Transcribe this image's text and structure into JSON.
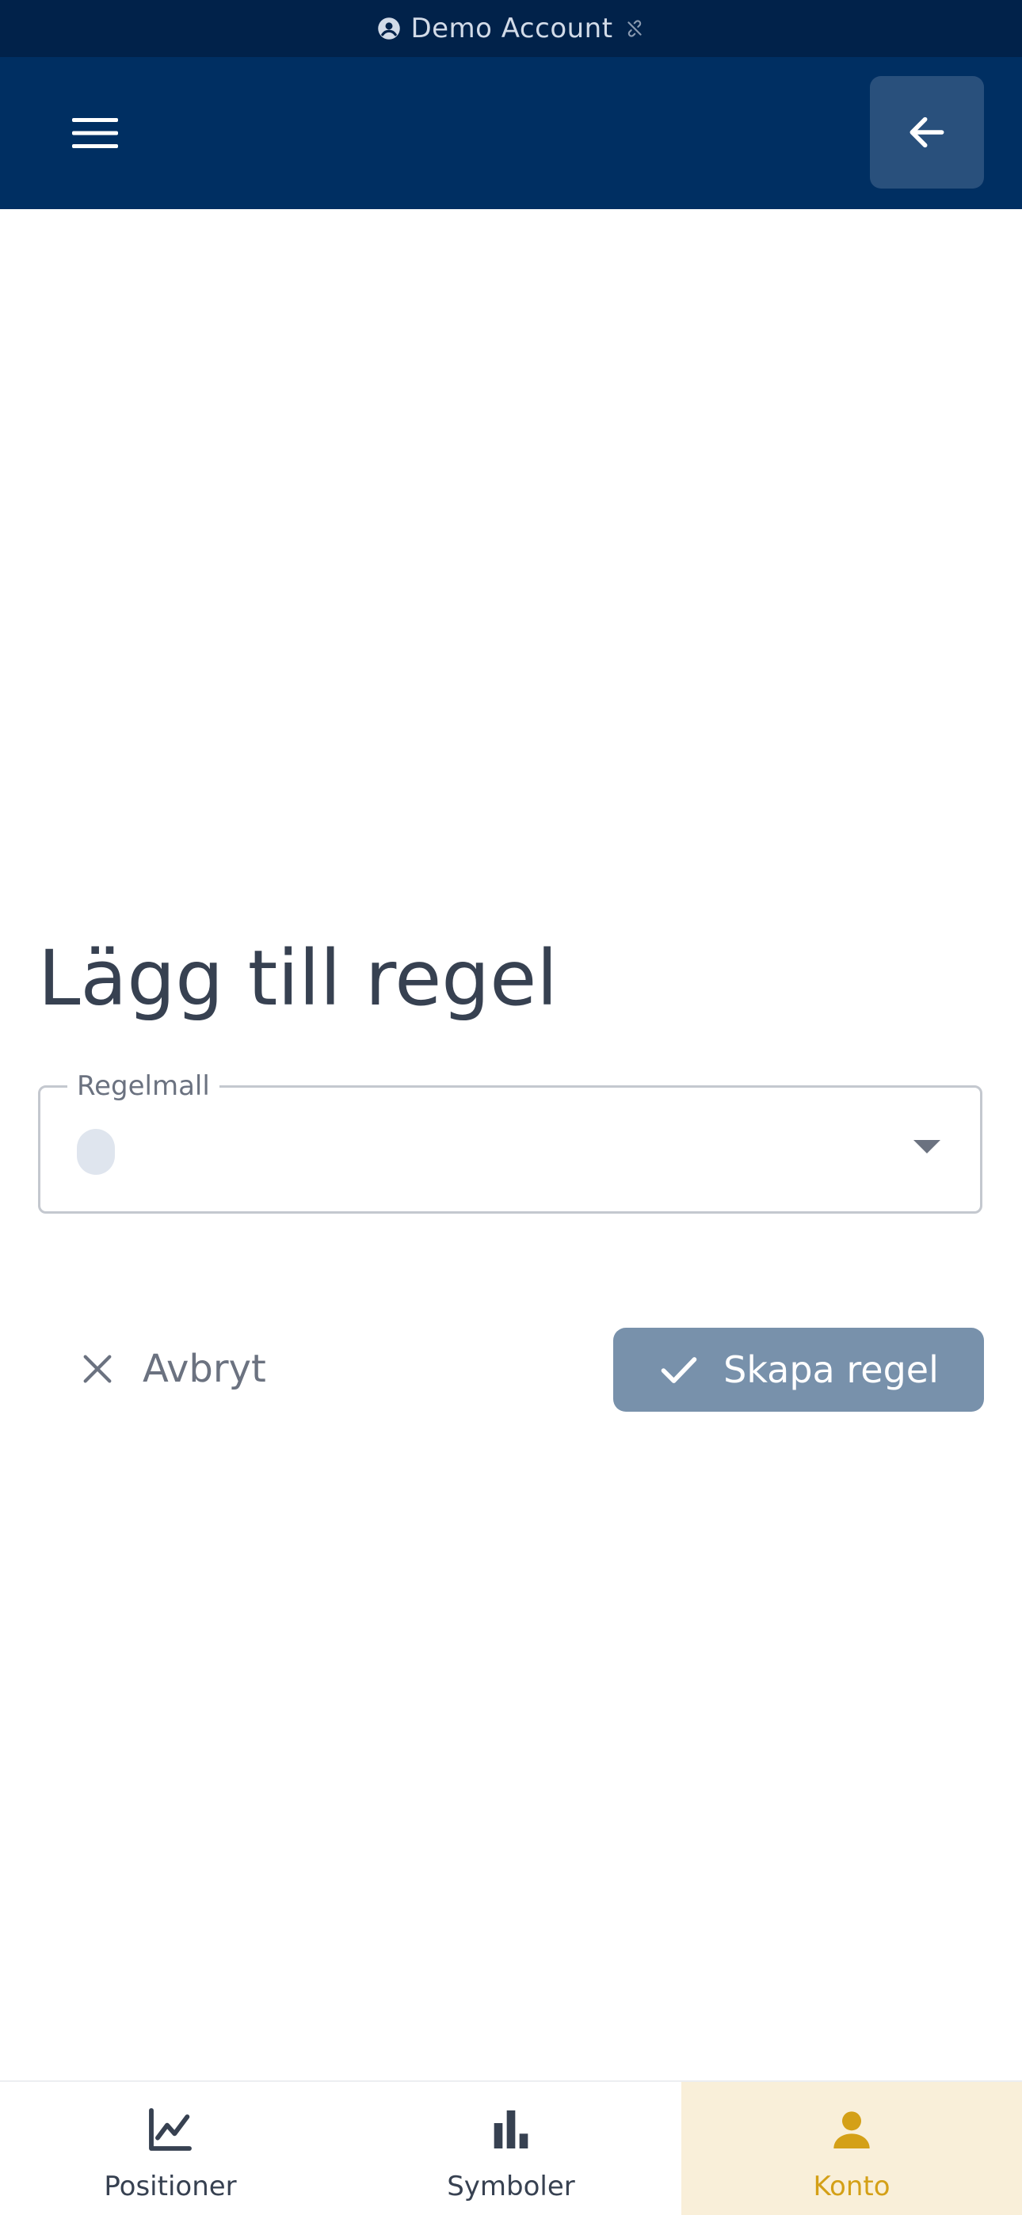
{
  "banner": {
    "account_label": "Demo Account",
    "account_icon": "account-circle-icon",
    "status_icon": "link-off-icon"
  },
  "app_bar": {
    "menu_icon": "hamburger-menu-icon",
    "back_icon": "arrow-left-icon"
  },
  "page": {
    "title": "Lägg till regel"
  },
  "form": {
    "template_label": "Regelmall",
    "template_value": ""
  },
  "actions": {
    "cancel_label": "Avbryt",
    "create_label": "Skapa regel"
  },
  "bottom_nav": {
    "items": [
      {
        "label": "Positioner",
        "icon": "line-chart-icon",
        "active": false
      },
      {
        "label": "Symboler",
        "icon": "bar-chart-icon",
        "active": false
      },
      {
        "label": "Konto",
        "icon": "person-icon",
        "active": true
      }
    ]
  },
  "colors": {
    "banner_bg": "#01224a",
    "app_bar_bg": "#002f62",
    "primary_button": "#7891ab",
    "active_nav_bg": "#f9efd9",
    "active_nav_fg": "#d4a017"
  }
}
